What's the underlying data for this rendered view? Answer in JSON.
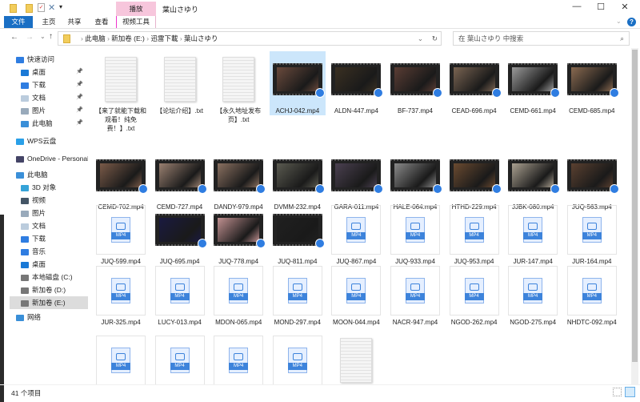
{
  "window": {
    "title": "葉山さゆり",
    "context_tab": "播放",
    "minimize": "—",
    "maximize": "☐",
    "close": "✕"
  },
  "ribbon": {
    "tabs": [
      "文件",
      "主页",
      "共享",
      "查看",
      "视频工具"
    ],
    "help": "?"
  },
  "address": {
    "back": "←",
    "forward": "→",
    "recent": "⌄",
    "up": "↑",
    "crumbs": [
      "此电脑",
      "新加卷 (E:)",
      "迅雷下載",
      "葉山さゆり"
    ],
    "refresh": "↻",
    "search_placeholder": "在 葉山さゆり 中搜索"
  },
  "sidebar": [
    {
      "label": "快速访问",
      "icon": "star",
      "color": "#2f7de1",
      "indent": 0
    },
    {
      "label": "桌面",
      "icon": "desktop",
      "color": "#1a79d6",
      "indent": 1,
      "pin": true
    },
    {
      "label": "下载",
      "icon": "download",
      "color": "#2f7de1",
      "indent": 1,
      "pin": true
    },
    {
      "label": "文档",
      "icon": "document",
      "color": "#bcd",
      "indent": 1,
      "pin": true
    },
    {
      "label": "图片",
      "icon": "pictures",
      "color": "#9ab",
      "indent": 1,
      "pin": true
    },
    {
      "label": "此电脑",
      "icon": "computer",
      "color": "#3a8fd8",
      "indent": 1,
      "pin": true
    },
    {
      "label": "WPS云盘",
      "icon": "cloud",
      "color": "#2aa0e8",
      "indent": 0
    },
    {
      "label": "OneDrive - Personal",
      "icon": "onedrive",
      "color": "#446",
      "indent": 0
    },
    {
      "label": "此电脑",
      "icon": "computer",
      "color": "#3a8fd8",
      "indent": 0
    },
    {
      "label": "3D 对象",
      "icon": "cube",
      "color": "#36a3d8",
      "indent": 1
    },
    {
      "label": "视频",
      "icon": "video",
      "color": "#456",
      "indent": 1
    },
    {
      "label": "图片",
      "icon": "pictures",
      "color": "#9ab",
      "indent": 1
    },
    {
      "label": "文档",
      "icon": "document",
      "color": "#bcd",
      "indent": 1
    },
    {
      "label": "下载",
      "icon": "download",
      "color": "#2f7de1",
      "indent": 1
    },
    {
      "label": "音乐",
      "icon": "music",
      "color": "#2f7de1",
      "indent": 1
    },
    {
      "label": "桌面",
      "icon": "desktop",
      "color": "#1a79d6",
      "indent": 1
    },
    {
      "label": "本地磁盘 (C:)",
      "icon": "drive",
      "color": "#777",
      "indent": 1
    },
    {
      "label": "新加卷 (D:)",
      "icon": "drive",
      "color": "#777",
      "indent": 1
    },
    {
      "label": "新加卷 (E:)",
      "icon": "drive",
      "color": "#777",
      "indent": 1,
      "selected": true
    },
    {
      "label": "网络",
      "icon": "network",
      "color": "#3a8fd8",
      "indent": 0
    }
  ],
  "files": [
    {
      "name": "【来了就能下载和观看！纯免费！】.txt",
      "type": "txt"
    },
    {
      "name": "【论坛介绍】.txt",
      "type": "txt"
    },
    {
      "name": "【永久地址发布页】.txt",
      "type": "txt"
    },
    {
      "name": "ACHJ-042.mp4",
      "type": "video",
      "color": "#6a4a3c",
      "selected": true
    },
    {
      "name": "ALDN-447.mp4",
      "type": "video",
      "color": "#3a3022"
    },
    {
      "name": "BF-737.mp4",
      "type": "video",
      "color": "#5a3d34"
    },
    {
      "name": "CEAD-696.mp4",
      "type": "video",
      "color": "#7a6452"
    },
    {
      "name": "CEMD-661.mp4",
      "type": "video",
      "color": "#9a9a9a"
    },
    {
      "name": "CEMD-685.mp4",
      "type": "video",
      "color": "#8a6a50"
    },
    {
      "name": "CEMD-702.mp4",
      "type": "video",
      "color": "#7a5a48"
    },
    {
      "name": "CEMD-727.mp4",
      "type": "video",
      "color": "#9a8070"
    },
    {
      "name": "DANDY-979.mp4",
      "type": "video",
      "color": "#8a7060"
    },
    {
      "name": "DVMM-232.mp4",
      "type": "video",
      "color": "#5a5a50"
    },
    {
      "name": "GARA-011.mp4",
      "type": "video",
      "color": "#4a4050"
    },
    {
      "name": "HALE-064.mp4",
      "type": "video",
      "color": "#8a8a8a"
    },
    {
      "name": "HTHD-229.mp4",
      "type": "video",
      "color": "#6a4a30"
    },
    {
      "name": "JJBK-080.mp4",
      "type": "video",
      "color": "#aaa090"
    },
    {
      "name": "JUQ-563.mp4",
      "type": "video",
      "color": "#5a4030"
    },
    {
      "name": "JUQ-599.mp4",
      "type": "mp4"
    },
    {
      "name": "JUQ-695.mp4",
      "type": "video",
      "color": "#1a1a40"
    },
    {
      "name": "JUQ-778.mp4",
      "type": "video",
      "color": "#c09090"
    },
    {
      "name": "JUQ-811.mp4",
      "type": "video",
      "color": "#202020"
    },
    {
      "name": "JUQ-867.mp4",
      "type": "mp4"
    },
    {
      "name": "JUQ-933.mp4",
      "type": "mp4"
    },
    {
      "name": "JUQ-953.mp4",
      "type": "mp4"
    },
    {
      "name": "JUR-147.mp4",
      "type": "mp4"
    },
    {
      "name": "JUR-164.mp4",
      "type": "mp4"
    },
    {
      "name": "JUR-325.mp4",
      "type": "mp4"
    },
    {
      "name": "LUCY-013.mp4",
      "type": "mp4"
    },
    {
      "name": "MDON-065.mp4",
      "type": "mp4"
    },
    {
      "name": "MOND-297.mp4",
      "type": "mp4"
    },
    {
      "name": "MOON-044.mp4",
      "type": "mp4"
    },
    {
      "name": "NACR-947.mp4",
      "type": "mp4"
    },
    {
      "name": "NGOD-262.mp4",
      "type": "mp4"
    },
    {
      "name": "NGOD-275.mp4",
      "type": "mp4"
    },
    {
      "name": "NHDTC-092.mp4",
      "type": "mp4"
    },
    {
      "type": "mp4"
    },
    {
      "type": "mp4"
    },
    {
      "type": "mp4"
    },
    {
      "type": "mp4"
    },
    {
      "type": "txt"
    }
  ],
  "status": {
    "count": "41 个项目"
  }
}
